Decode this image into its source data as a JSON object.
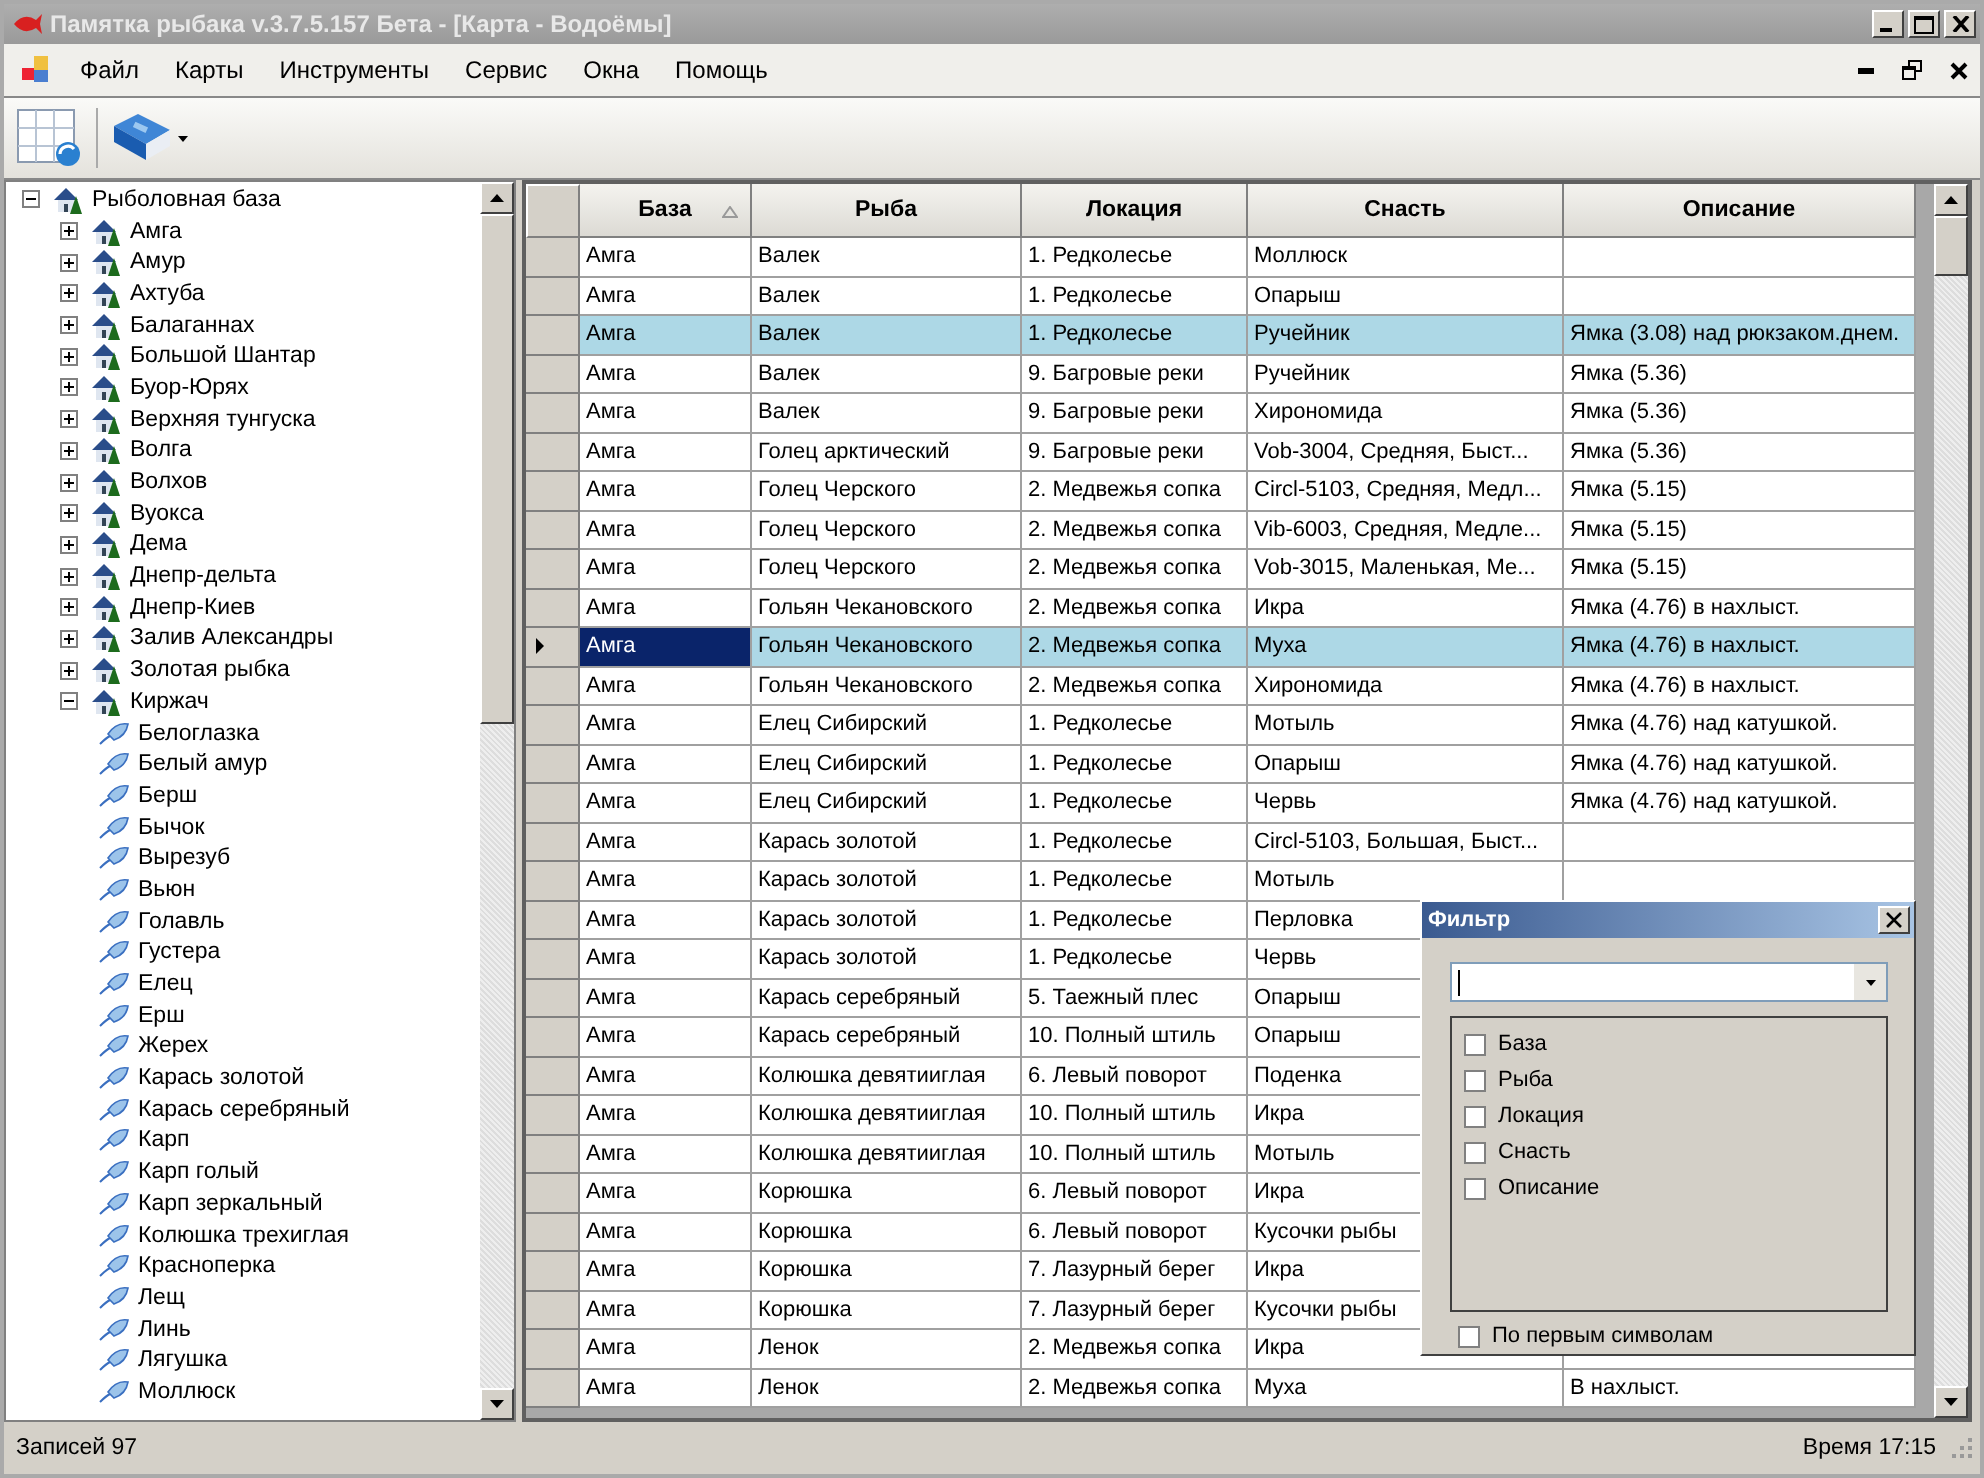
{
  "window": {
    "title": "Памятка рыбака v.3.7.5.157 Бета - [Карта - Водоёмы]"
  },
  "menu": [
    "Файл",
    "Карты",
    "Инструменты",
    "Сервис",
    "Окна",
    "Помощь"
  ],
  "tree": {
    "label": "Рыболовная база",
    "kind": "base",
    "expanded": true,
    "children": [
      {
        "label": "Амга",
        "kind": "base",
        "expanded": false
      },
      {
        "label": "Амур",
        "kind": "base",
        "expanded": false
      },
      {
        "label": "Ахтуба",
        "kind": "base",
        "expanded": false
      },
      {
        "label": "Балаганнах",
        "kind": "base",
        "expanded": false
      },
      {
        "label": "Большой Шантар",
        "kind": "base",
        "expanded": false
      },
      {
        "label": "Буор-Юрях",
        "kind": "base",
        "expanded": false
      },
      {
        "label": "Верхняя тунгуска",
        "kind": "base",
        "expanded": false
      },
      {
        "label": "Волга",
        "kind": "base",
        "expanded": false
      },
      {
        "label": "Волхов",
        "kind": "base",
        "expanded": false
      },
      {
        "label": "Вуокса",
        "kind": "base",
        "expanded": false
      },
      {
        "label": "Дема",
        "kind": "base",
        "expanded": false
      },
      {
        "label": "Днепр-дельта",
        "kind": "base",
        "expanded": false
      },
      {
        "label": "Днепр-Киев",
        "kind": "base",
        "expanded": false
      },
      {
        "label": "Залив Александры",
        "kind": "base",
        "expanded": false
      },
      {
        "label": "Золотая рыбка",
        "kind": "base",
        "expanded": false
      },
      {
        "label": "Киржач",
        "kind": "base",
        "expanded": true,
        "children": [
          {
            "label": "Белоглазка",
            "kind": "fish"
          },
          {
            "label": "Белый амур",
            "kind": "fish"
          },
          {
            "label": "Берш",
            "kind": "fish"
          },
          {
            "label": "Бычок",
            "kind": "fish"
          },
          {
            "label": "Вырезуб",
            "kind": "fish"
          },
          {
            "label": "Вьюн",
            "kind": "fish"
          },
          {
            "label": "Голавль",
            "kind": "fish"
          },
          {
            "label": "Густера",
            "kind": "fish"
          },
          {
            "label": "Елец",
            "kind": "fish"
          },
          {
            "label": "Ерш",
            "kind": "fish"
          },
          {
            "label": "Жерех",
            "kind": "fish"
          },
          {
            "label": "Карась золотой",
            "kind": "fish"
          },
          {
            "label": "Карась серебряный",
            "kind": "fish"
          },
          {
            "label": "Карп",
            "kind": "fish"
          },
          {
            "label": "Карп голый",
            "kind": "fish"
          },
          {
            "label": "Карп зеркальный",
            "kind": "fish"
          },
          {
            "label": "Колюшка трехиглая",
            "kind": "fish"
          },
          {
            "label": "Красноперка",
            "kind": "fish"
          },
          {
            "label": "Лещ",
            "kind": "fish"
          },
          {
            "label": "Линь",
            "kind": "fish"
          },
          {
            "label": "Лягушка",
            "kind": "fish"
          },
          {
            "label": "Моллюск",
            "kind": "fish"
          }
        ]
      }
    ]
  },
  "table": {
    "columns": [
      {
        "label": "База",
        "sorted": true
      },
      {
        "label": "Рыба",
        "sorted": false
      },
      {
        "label": "Локация",
        "sorted": false
      },
      {
        "label": "Снасть",
        "sorted": false
      },
      {
        "label": "Описание",
        "sorted": false
      }
    ],
    "rows": [
      {
        "base": "Амга",
        "fish": "Валек",
        "location": "1. Редколесье",
        "tackle": "Моллюск",
        "selected": false,
        "current": false
      },
      {
        "base": "Амга",
        "fish": "Валек",
        "location": "1. Редколесье",
        "tackle": "Опарыш",
        "selected": false,
        "current": false
      },
      {
        "base": "Амга",
        "fish": "Валек",
        "location": "1. Редколесье",
        "tackle": "Ручейник",
        "description": "Ямка (3.08) над рюкзаком.днем.",
        "selected": true,
        "current": false
      },
      {
        "base": "Амга",
        "fish": "Валек",
        "location": "9. Багровые реки",
        "tackle": "Ручейник",
        "description": "Ямка (5.36)",
        "selected": false,
        "current": false
      },
      {
        "base": "Амга",
        "fish": "Валек",
        "location": "9. Багровые реки",
        "tackle": "Хирономида",
        "description": "Ямка (5.36)",
        "selected": false,
        "current": false
      },
      {
        "base": "Амга",
        "fish": "Голец арктический",
        "location": "9. Багровые реки",
        "tackle": "Vob-3004, Средняя, Быст...",
        "description": "Ямка (5.36)",
        "selected": false,
        "current": false
      },
      {
        "base": "Амга",
        "fish": "Голец Черского",
        "location": "2. Медвежья сопка",
        "tackle": "Circl-5103, Средняя, Медл...",
        "description": "Ямка (5.15)",
        "selected": false,
        "current": false
      },
      {
        "base": "Амга",
        "fish": "Голец Черского",
        "location": "2. Медвежья сопка",
        "tackle": "Vib-6003, Средняя, Медле...",
        "description": "Ямка (5.15)",
        "selected": false,
        "current": false
      },
      {
        "base": "Амга",
        "fish": "Голец Черского",
        "location": "2. Медвежья сопка",
        "tackle": "Vob-3015, Маленькая, Ме...",
        "description": "Ямка (5.15)",
        "selected": false,
        "current": false
      },
      {
        "base": "Амга",
        "fish": "Гольян Чекановского",
        "location": "2. Медвежья сопка",
        "tackle": "Икра",
        "description": "Ямка (4.76) в нахлыст.",
        "selected": false,
        "current": false
      },
      {
        "base": "Амга",
        "fish": "Гольян Чекановского",
        "location": "2. Медвежья сопка",
        "tackle": "Муха",
        "description": "Ямка (4.76) в нахлыст.",
        "selected": true,
        "current": true
      },
      {
        "base": "Амга",
        "fish": "Гольян Чекановского",
        "location": "2. Медвежья сопка",
        "tackle": "Хирономида",
        "description": "Ямка (4.76) в нахлыст.",
        "selected": false,
        "current": false
      },
      {
        "base": "Амга",
        "fish": "Елец Сибирский",
        "location": "1. Редколесье",
        "tackle": "Мотыль",
        "description": "Ямка (4.76) над катушкой.",
        "selected": false,
        "current": false
      },
      {
        "base": "Амга",
        "fish": "Елец Сибирский",
        "location": "1. Редколесье",
        "tackle": "Опарыш",
        "description": "Ямка (4.76) над катушкой.",
        "selected": false,
        "current": false
      },
      {
        "base": "Амга",
        "fish": "Елец Сибирский",
        "location": "1. Редколесье",
        "tackle": "Червь",
        "description": "Ямка (4.76) над катушкой.",
        "selected": false,
        "current": false
      },
      {
        "base": "Амга",
        "fish": "Карась золотой",
        "location": "1. Редколесье",
        "tackle": "Circl-5103, Большая, Быст...",
        "selected": false,
        "current": false
      },
      {
        "base": "Амга",
        "fish": "Карась золотой",
        "location": "1. Редколесье",
        "tackle": "Мотыль",
        "selected": false,
        "current": false
      },
      {
        "base": "Амга",
        "fish": "Карась золотой",
        "location": "1. Редколесье",
        "tackle": "Перловка",
        "selected": false,
        "current": false
      },
      {
        "base": "Амга",
        "fish": "Карась золотой",
        "location": "1. Редколесье",
        "tackle": "Червь",
        "selected": false,
        "current": false
      },
      {
        "base": "Амга",
        "fish": "Карась серебряный",
        "location": "5. Таежный плес",
        "tackle": "Опарыш",
        "selected": false,
        "current": false
      },
      {
        "base": "Амга",
        "fish": "Карась серебряный",
        "location": "10. Полный штиль",
        "tackle": "Опарыш",
        "selected": false,
        "current": false
      },
      {
        "base": "Амга",
        "fish": "Колюшка девятииглая",
        "location": "6. Левый поворот",
        "tackle": "Поденка",
        "selected": false,
        "current": false
      },
      {
        "base": "Амга",
        "fish": "Колюшка девятииглая",
        "location": "10. Полный штиль",
        "tackle": "Икра",
        "selected": false,
        "current": false
      },
      {
        "base": "Амга",
        "fish": "Колюшка девятииглая",
        "location": "10. Полный штиль",
        "tackle": "Мотыль",
        "selected": false,
        "current": false
      },
      {
        "base": "Амга",
        "fish": "Корюшка",
        "location": "6. Левый поворот",
        "tackle": "Икра",
        "selected": false,
        "current": false
      },
      {
        "base": "Амга",
        "fish": "Корюшка",
        "location": "6. Левый поворот",
        "tackle": "Кусочки рыбы",
        "selected": false,
        "current": false
      },
      {
        "base": "Амга",
        "fish": "Корюшка",
        "location": "7. Лазурный берег",
        "tackle": "Икра",
        "selected": false,
        "current": false
      },
      {
        "base": "Амга",
        "fish": "Корюшка",
        "location": "7. Лазурный берег",
        "tackle": "Кусочки рыбы",
        "selected": false,
        "current": false
      },
      {
        "base": "Амга",
        "fish": "Ленок",
        "location": "2. Медвежья сопка",
        "tackle": "Икра",
        "selected": false,
        "current": false
      },
      {
        "base": "Амга",
        "fish": "Ленок",
        "location": "2. Медвежья сопка",
        "tackle": "Муха",
        "description": "В нахлыст.",
        "selected": false,
        "current": false
      }
    ]
  },
  "filter_dialog": {
    "title": "Фильтр",
    "fields": [
      {
        "label": "База",
        "checked": false
      },
      {
        "label": "Рыба",
        "checked": false
      },
      {
        "label": "Локация",
        "checked": false
      },
      {
        "label": "Снасть",
        "checked": false
      },
      {
        "label": "Описание",
        "checked": false
      }
    ],
    "first_chars": {
      "label": "По первым символам",
      "checked": false
    }
  },
  "status_bar": {
    "records": "Записей 97",
    "time": "Время 17:15"
  }
}
